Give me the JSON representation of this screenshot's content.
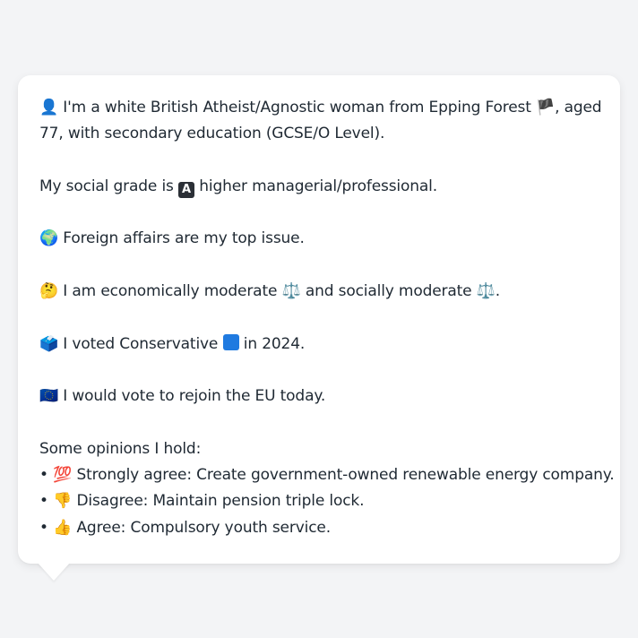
{
  "bio": {
    "line1": {
      "emoji": "👤",
      "text_a": "I'm a white British Atheist/Agnostic woman from Epping Forest",
      "flag": "🏴",
      "text_b": ", aged"
    },
    "line2": "77, with secondary education (GCSE/O Level).",
    "social_grade": {
      "text_a": "My social grade is",
      "badge": "A",
      "text_b": "higher managerial/professional."
    },
    "top_issue": {
      "emoji": "🌍",
      "text": "Foreign affairs are my top issue."
    },
    "economics": {
      "emoji": "🤔",
      "text_a": "I am economically moderate",
      "icon_a": "⚖️",
      "text_b": "and socially moderate",
      "icon_b": "⚖️",
      "text_c": "."
    },
    "vote": {
      "emoji": "🗳️",
      "text_a": "I voted Conservative",
      "text_b": "in 2024."
    },
    "eu": {
      "emoji": "🇪🇺",
      "text": "I would vote to rejoin the EU today."
    }
  },
  "opinions": {
    "heading": "Some opinions I hold:",
    "items": [
      {
        "bullet": "•",
        "emoji": "💯",
        "text": "Strongly agree: Create government-owned renewable energy company."
      },
      {
        "bullet": "•",
        "emoji": "👎",
        "text": "Disagree: Maintain pension triple lock."
      },
      {
        "bullet": "•",
        "emoji": "👍",
        "text": "Agree: Compulsory youth service."
      }
    ]
  },
  "colors": {
    "background": "#f3f4f6",
    "card": "#ffffff",
    "text": "#1f2933",
    "conservative_blue": "#1f7ae0"
  }
}
